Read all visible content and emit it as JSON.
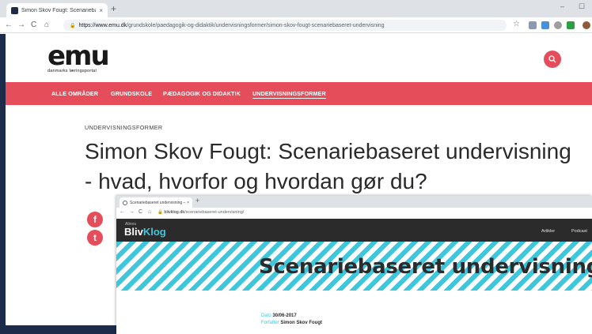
{
  "browser": {
    "tab_title": "Simon Skov Fougt: Scenariebase",
    "tab_close": "×",
    "new_tab": "+",
    "url_host": "https://www.emu.dk",
    "url_path": "/grundskole/paedagogik-og-didaktik/undervisningsformer/simon-skov-fougt-scenariebaseret-undervisning",
    "back": "←",
    "forward": "→",
    "reload": "C",
    "home": "⌂",
    "minimize": "–",
    "maximize": "☐"
  },
  "site": {
    "logo_text": "emu",
    "logo_sub": "danmarks læringsportal",
    "nav": [
      "ALLE OMRÅDER",
      "GRUNDSKOLE",
      "PÆDAGOGIK OG DIDAKTIK",
      "UNDERVISNINGSFORMER"
    ],
    "kicker": "UNDERVISNINGSFORMER",
    "title": "Simon Skov Fougt: Scenariebaseret undervisning - hvad, hvorfor og hvordan gør du?",
    "facebook": "f",
    "twitter": "t"
  },
  "inner": {
    "tab_title": "Scenariebaseret undervisning – ",
    "tab_close": "×",
    "new_tab": "+",
    "url_host": "blivklog.dk",
    "url_path": "/scenariebaseret-undervisning/",
    "brand_small": "Alinea",
    "brand_a": "Bliv",
    "brand_b": "Klog",
    "nav": [
      "Artikler",
      "Podcast"
    ],
    "hero_title": "Scenariebaseret undervisning",
    "date_label": "Dato ",
    "date_value": "30/06-2017",
    "author_label": "Forfatter ",
    "author_value": "Simon Skov Fougt"
  },
  "colors": {
    "accent": "#e64d5a",
    "navy": "#1c2b4a",
    "cyan": "#3ec7dc"
  }
}
